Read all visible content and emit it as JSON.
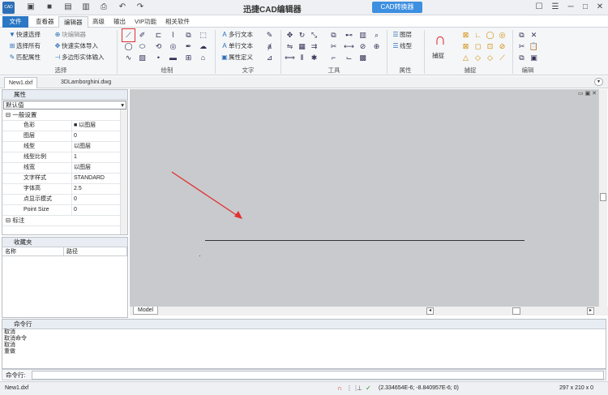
{
  "title": {
    "app_name": "迅捷CAD编辑器",
    "logo": "CAD",
    "convert_button": "CAD转换器"
  },
  "quick_access": [
    "new-icon",
    "open-icon",
    "save-icon",
    "save-as-icon",
    "print-icon",
    "undo-icon",
    "redo-icon"
  ],
  "menu": {
    "file": "文件",
    "tabs": [
      "查看器",
      "编辑器",
      "高级",
      "输出",
      "VIP功能",
      "相关软件"
    ],
    "active_tab": "编辑器"
  },
  "ribbon": {
    "select": {
      "quick_select": "快速选择",
      "select_all": "选择所有",
      "match_props": "匹配属性",
      "block_editor": "块编辑器",
      "quick_entity_import": "快速实体导入",
      "poly_entity_import": "多边形实体输入",
      "label": "选择"
    },
    "draw": {
      "label": "绘制"
    },
    "text": {
      "mtext": "多行文本",
      "single_text": "单行文本",
      "attdef": "属性定义",
      "label": "文字"
    },
    "tools": {
      "label": "工具"
    },
    "properties": {
      "layer": "图层",
      "linetype": "线型",
      "label": "属性"
    },
    "snap": {
      "button": "捕捉",
      "label": "捕捉"
    },
    "edit": {
      "label": "编辑"
    }
  },
  "doc_tabs": [
    "New1.dxf",
    "3DLamborghini.dwg"
  ],
  "properties_panel": {
    "title": "属性",
    "selector": "默认值",
    "group_general": "一般设置",
    "rows": [
      {
        "k": "色彩",
        "v": "■ 以图层"
      },
      {
        "k": "图层",
        "v": "0"
      },
      {
        "k": "线型",
        "v": "以图层"
      },
      {
        "k": "线型比例",
        "v": "1"
      },
      {
        "k": "线宽",
        "v": "以图层"
      },
      {
        "k": "文字样式",
        "v": "STANDARD"
      },
      {
        "k": "字体高",
        "v": "2.5"
      },
      {
        "k": "点显示模式",
        "v": "0"
      },
      {
        "k": "Point Size",
        "v": "0"
      }
    ],
    "group_dim": "标注"
  },
  "favorites": {
    "title": "收藏夹",
    "col_name": "名称",
    "col_path": "路径"
  },
  "canvas": {
    "model_tab": "Model"
  },
  "command": {
    "title": "命令行",
    "history": [
      "取消",
      "取消命令",
      "取消",
      "重做"
    ],
    "prompt": "命令行:"
  },
  "status": {
    "file": "New1.dxf",
    "coords": "(2.334654E-6; -8.840957E-6; 0)",
    "paper": "297 x 210 x 0"
  },
  "colors": {
    "accent": "#2b78c5",
    "highlight": "#e23030",
    "arrow": "#e23030"
  }
}
